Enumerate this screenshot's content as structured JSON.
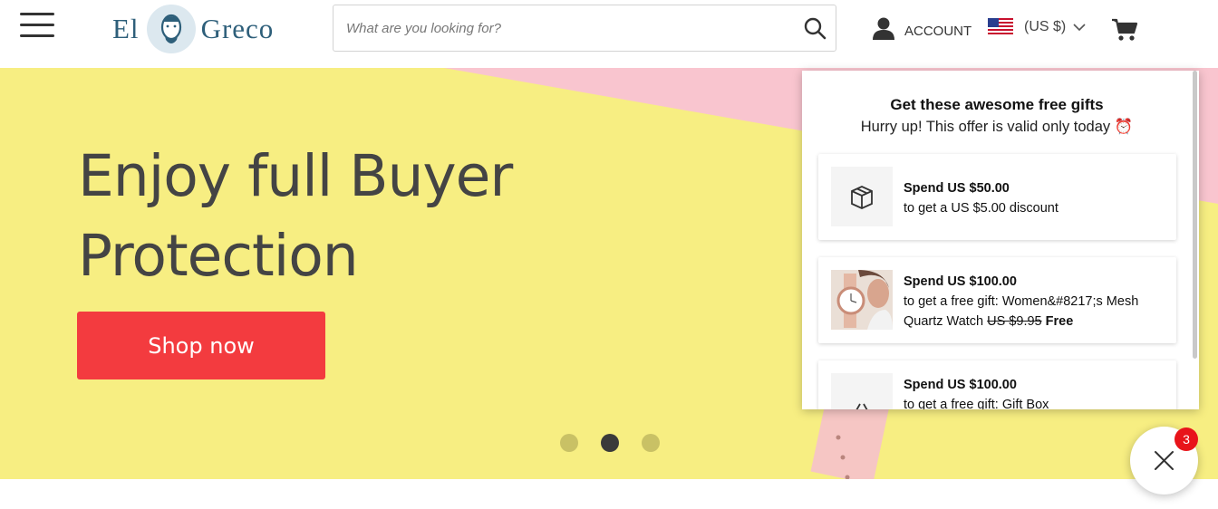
{
  "header": {
    "logo_left": "El",
    "logo_right": "Greco",
    "search_placeholder": "What are you looking for?",
    "account_label": "ACCOUNT",
    "currency_label": "(US $)"
  },
  "hero": {
    "title_line1": "Enjoy full Buyer",
    "title_line2": "Protection",
    "cta_label": "Shop now",
    "slides": 3,
    "active_slide": 2
  },
  "popup": {
    "title": "Get these awesome free gifts",
    "subtitle": "Hurry up! This offer is valid only today ⏰",
    "gifts": [
      {
        "threshold": "Spend US $50.00",
        "desc": "to get a US $5.00 discount",
        "icon": "box-icon"
      },
      {
        "threshold": "Spend US $100.00",
        "desc": "to get a free gift: Women&#8217;s Mesh Quartz Watch",
        "old_price": "US $9.95",
        "free_label": "Free",
        "icon": "watch-thumbnail"
      },
      {
        "threshold": "Spend US $100.00",
        "desc": "to get a free gift: Gift Box",
        "icon": "basket-icon"
      }
    ]
  },
  "bubble": {
    "badge_count": "3"
  },
  "colors": {
    "accent_red": "#f33b3f",
    "hero_yellow": "#f7ee82",
    "hero_pink": "#f9c5cf",
    "logo_blue": "#2e5f7a"
  }
}
